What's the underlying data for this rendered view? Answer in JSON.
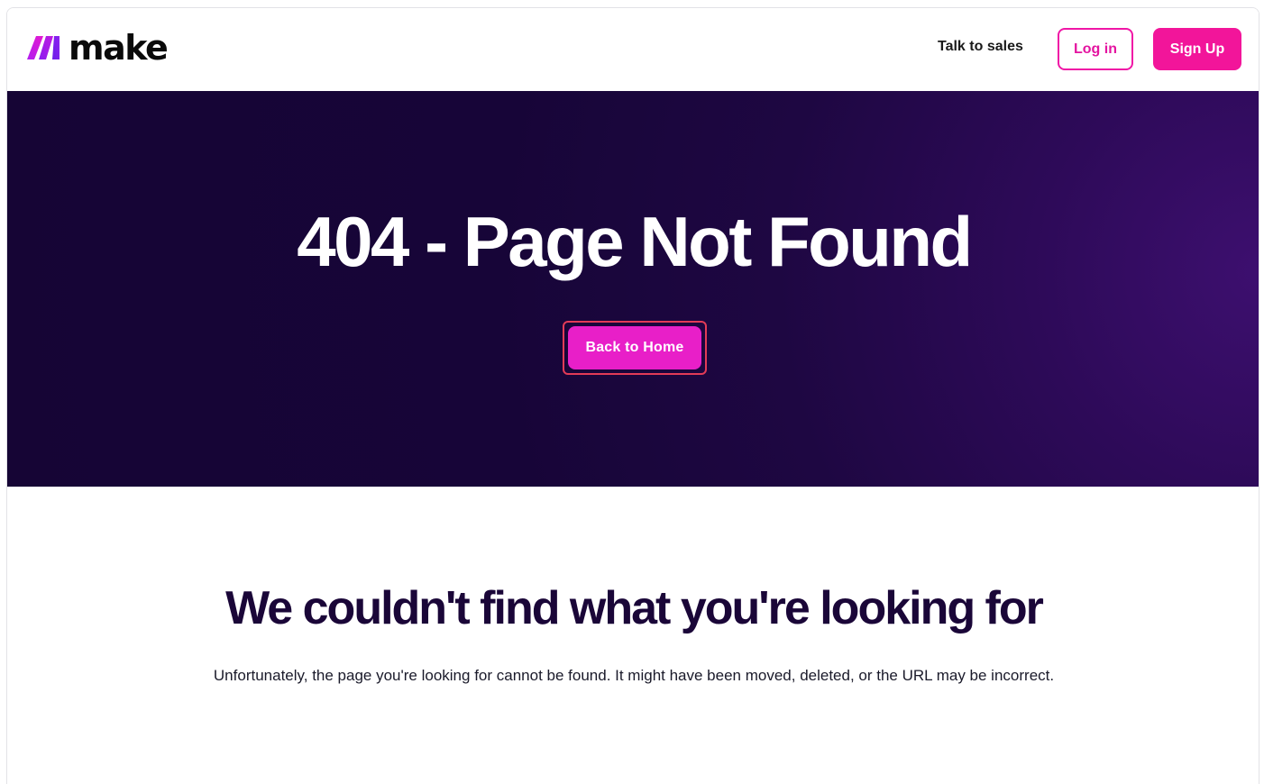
{
  "header": {
    "logo_text": "make",
    "talk_to_sales": "Talk to sales",
    "login_label": "Log in",
    "signup_label": "Sign Up"
  },
  "hero": {
    "title": "404 - Page Not Found",
    "back_home_label": "Back to Home"
  },
  "content": {
    "heading": "We couldn't find what you're looking for",
    "description": "Unfortunately, the page you're looking for cannot be found. It might have been moved, deleted, or the URL may be incorrect."
  },
  "colors": {
    "brand_pink": "#f2159a",
    "brand_magenta": "#e81fc8",
    "hero_background": "#160535",
    "heading_text": "#1a0638"
  },
  "icons": {
    "logo_mark": "make-logo-icon"
  }
}
